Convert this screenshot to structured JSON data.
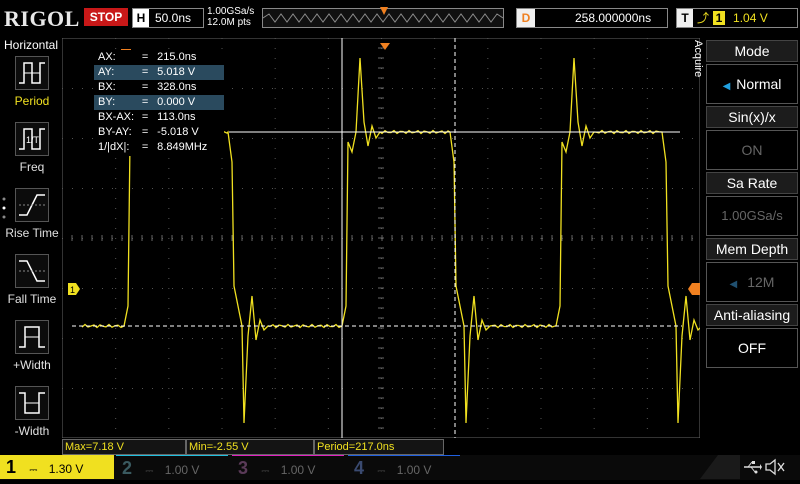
{
  "brand": "RIGOL",
  "run_state": "STOP",
  "horizontal": {
    "label": "H",
    "timebase": "50.0ns",
    "sample_rate": "1.00GSa/s",
    "points": "12.0M pts"
  },
  "delay": {
    "label": "D",
    "value": "258.000000ns"
  },
  "trigger": {
    "label": "T",
    "source": "1",
    "level": "1.04 V"
  },
  "left_menu": {
    "title": "Horizontal",
    "items": [
      {
        "label": "Period",
        "icon": "period-icon",
        "selected": true
      },
      {
        "label": "Freq",
        "icon": "freq-icon",
        "selected": false
      },
      {
        "label": "Rise Time",
        "icon": "rise-time-icon",
        "selected": false
      },
      {
        "label": "Fall Time",
        "icon": "fall-time-icon",
        "selected": false
      },
      {
        "label": "+Width",
        "icon": "pos-width-icon",
        "selected": false
      },
      {
        "label": "-Width",
        "icon": "neg-width-icon",
        "selected": false
      }
    ]
  },
  "measure_panel": {
    "rows": [
      {
        "name": "AX:",
        "eq": "=",
        "value": "215.0ns",
        "highlight": false
      },
      {
        "name": "AY:",
        "eq": "=",
        "value": "5.018 V",
        "highlight": true
      },
      {
        "name": "BX:",
        "eq": "=",
        "value": "328.0ns",
        "highlight": false
      },
      {
        "name": "BY:",
        "eq": "=",
        "value": "0.000 V",
        "highlight": true
      },
      {
        "name": "BX-AX:",
        "eq": "=",
        "value": "113.0ns",
        "highlight": false
      },
      {
        "name": "BY-AY:",
        "eq": "=",
        "value": "-5.018 V",
        "highlight": false
      },
      {
        "name": "1/|dX|:",
        "eq": "=",
        "value": "8.849MHz",
        "highlight": false
      }
    ]
  },
  "right_menu": {
    "tab": "Acquire",
    "items": [
      {
        "header": "Mode",
        "value": "Normal",
        "enabled": true,
        "arrow": true
      },
      {
        "header": "Sin(x)/x",
        "value": "ON",
        "enabled": false,
        "arrow": false
      },
      {
        "header": "Sa Rate",
        "value": "1.00GSa/s",
        "enabled": false,
        "arrow": false
      },
      {
        "header": "Mem Depth",
        "value": "12M",
        "enabled": false,
        "arrow": true
      },
      {
        "header": "Anti-aliasing",
        "value": "OFF",
        "enabled": true,
        "arrow": false
      }
    ]
  },
  "stats": {
    "max": "Max=7.18 V",
    "min": "Min=-2.55 V",
    "period": "Period=217.0ns"
  },
  "channels": [
    {
      "num": "1",
      "scale": "1.30 V",
      "active": true
    },
    {
      "num": "2",
      "scale": "1.00 V",
      "active": false
    },
    {
      "num": "3",
      "scale": "1.00 V",
      "active": false
    },
    {
      "num": "4",
      "scale": "1.00 V",
      "active": false
    }
  ],
  "colors": {
    "ch1": "#f0e020",
    "ch2": "#20c0e0",
    "ch3": "#e020c0",
    "ch4": "#2060e0",
    "stop": "#c81818",
    "orange": "#f08020"
  }
}
